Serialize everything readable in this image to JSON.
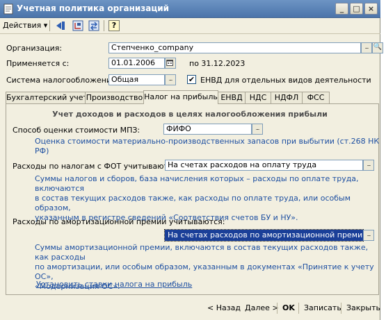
{
  "window": {
    "title": "Учетная политика организаций",
    "minimize_icon": "minimize-icon",
    "maximize_icon": "maximize-icon",
    "close_icon": "close-icon"
  },
  "toolbar": {
    "actions_label": "Действия",
    "help_label": "?"
  },
  "org": {
    "label": "Организация:",
    "value": "Степченко_company"
  },
  "applies": {
    "label": "Применяется с:",
    "date": "01.01.2006",
    "until": "по 31.12.2023"
  },
  "tax_system": {
    "label": "Система налогообложения:",
    "value": "Общая",
    "envd_checked": true,
    "envd_label": "ЕНВД для отдельных видов деятельности"
  },
  "tabs": [
    {
      "label": "Бухгалтерский учет",
      "active": false
    },
    {
      "label": "Производство",
      "active": false
    },
    {
      "label": "Налог на прибыль",
      "active": true
    },
    {
      "label": "ЕНВД",
      "active": false
    },
    {
      "label": "НДС",
      "active": false
    },
    {
      "label": "НДФЛ",
      "active": false
    },
    {
      "label": "ФСС",
      "active": false
    }
  ],
  "tab_content": {
    "section_title": "Учет доходов и расходов в целях налогообложения прибыли",
    "mpz": {
      "label": "Способ оценки стоимости МПЗ:",
      "value": "ФИФО",
      "desc": "Оценка стоимости материально-производственных запасов при выбытии (ст.268 НК РФ)"
    },
    "fot": {
      "label": "Расходы по налогам с ФОТ учитываются:",
      "value": "На счетах расходов на оплату труда",
      "desc": [
        "Суммы налогов и сборов, база начисления которых – расходы по оплате труда, включаются",
        "в состав текущих расходов также, как расходы по оплате труда, или особым образом,",
        "указанным в регистре сведений «Соответствия счетов БУ и НУ»."
      ]
    },
    "amort": {
      "label": "Расходы по амортизационной премии учитываются:",
      "value": "На счетах расходов по амортизационной премии",
      "desc": [
        "Суммы амортизационной премии, включаются в состав текущих расходов также, как расходы",
        "по амортизации, или особым образом, указанным в документах «Принятие к учету ОС»,",
        "«Модернизация ОС»."
      ]
    },
    "link": "Установить ставки налога на прибыль"
  },
  "bottom": {
    "back": "< Назад",
    "next": "Далее >",
    "ok": "OK",
    "save": "Записать",
    "close": "Закрыть"
  },
  "colors": {
    "titlebar": "#4b74aa",
    "window_bg": "#f2efe0",
    "link_blue": "#1d4fa1",
    "selection": "#1a3f98"
  }
}
